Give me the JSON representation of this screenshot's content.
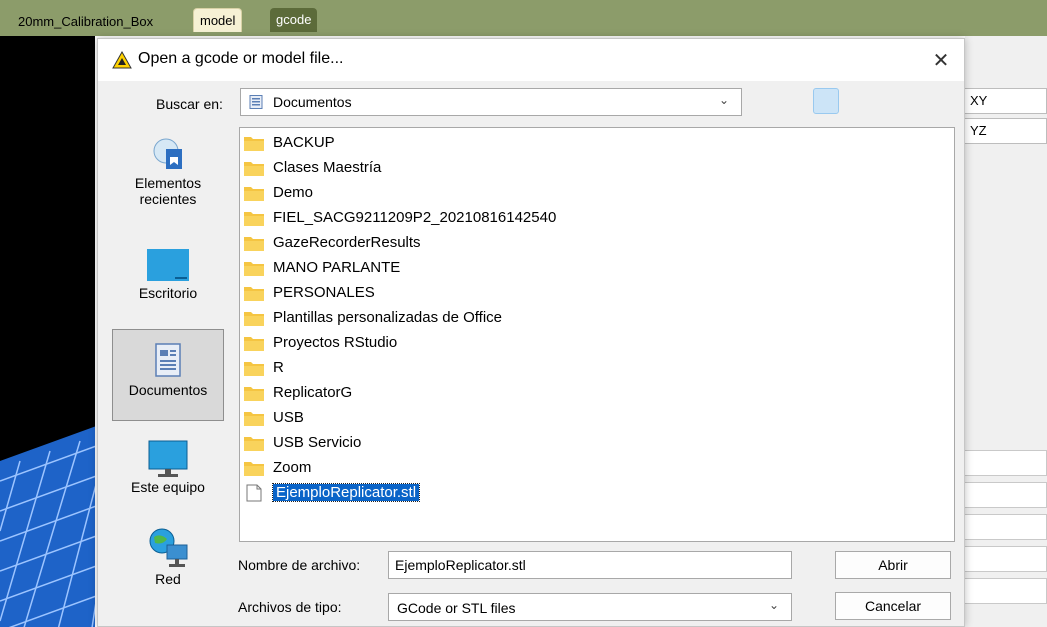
{
  "app": {
    "tabs": [
      "20mm_Calibration_Box",
      "model",
      "gcode"
    ],
    "view_buttons": [
      "XY",
      "YZ"
    ]
  },
  "dialog": {
    "title": "Open a gcode or model file...",
    "lookin_label": "Buscar en:",
    "lookin_value": "Documentos",
    "places": [
      {
        "label": "Elementos recientes",
        "icon": "recent-items-icon"
      },
      {
        "label": "Escritorio",
        "icon": "desktop-icon"
      },
      {
        "label": "Documentos",
        "icon": "documents-icon",
        "selected": true
      },
      {
        "label": "Este equipo",
        "icon": "computer-icon"
      },
      {
        "label": "Red",
        "icon": "network-icon"
      }
    ],
    "files": [
      {
        "name": "BACKUP",
        "type": "folder"
      },
      {
        "name": "Clases Maestría",
        "type": "folder"
      },
      {
        "name": "Demo",
        "type": "folder"
      },
      {
        "name": "FIEL_SACG9211209P2_20210816142540",
        "type": "folder"
      },
      {
        "name": "GazeRecorderResults",
        "type": "folder"
      },
      {
        "name": "MANO PARLANTE",
        "type": "folder"
      },
      {
        "name": "PERSONALES",
        "type": "folder"
      },
      {
        "name": "Plantillas personalizadas de Office",
        "type": "folder"
      },
      {
        "name": "Proyectos RStudio",
        "type": "folder"
      },
      {
        "name": "R",
        "type": "folder"
      },
      {
        "name": "ReplicatorG",
        "type": "folder"
      },
      {
        "name": "USB",
        "type": "folder"
      },
      {
        "name": "USB Servicio",
        "type": "folder"
      },
      {
        "name": "Zoom",
        "type": "folder"
      },
      {
        "name": "EjemploReplicator.stl",
        "type": "file",
        "selected": true
      }
    ],
    "filename_label": "Nombre de archivo:",
    "filename_value": "EjemploReplicator.stl",
    "filetype_label": "Archivos de tipo:",
    "filetype_value": "GCode or STL files",
    "open_label": "Abrir",
    "cancel_label": "Cancelar"
  },
  "colors": {
    "app_bar": "#8c9c6a",
    "folder": "#f5c542",
    "selection": "#0a64c8"
  }
}
